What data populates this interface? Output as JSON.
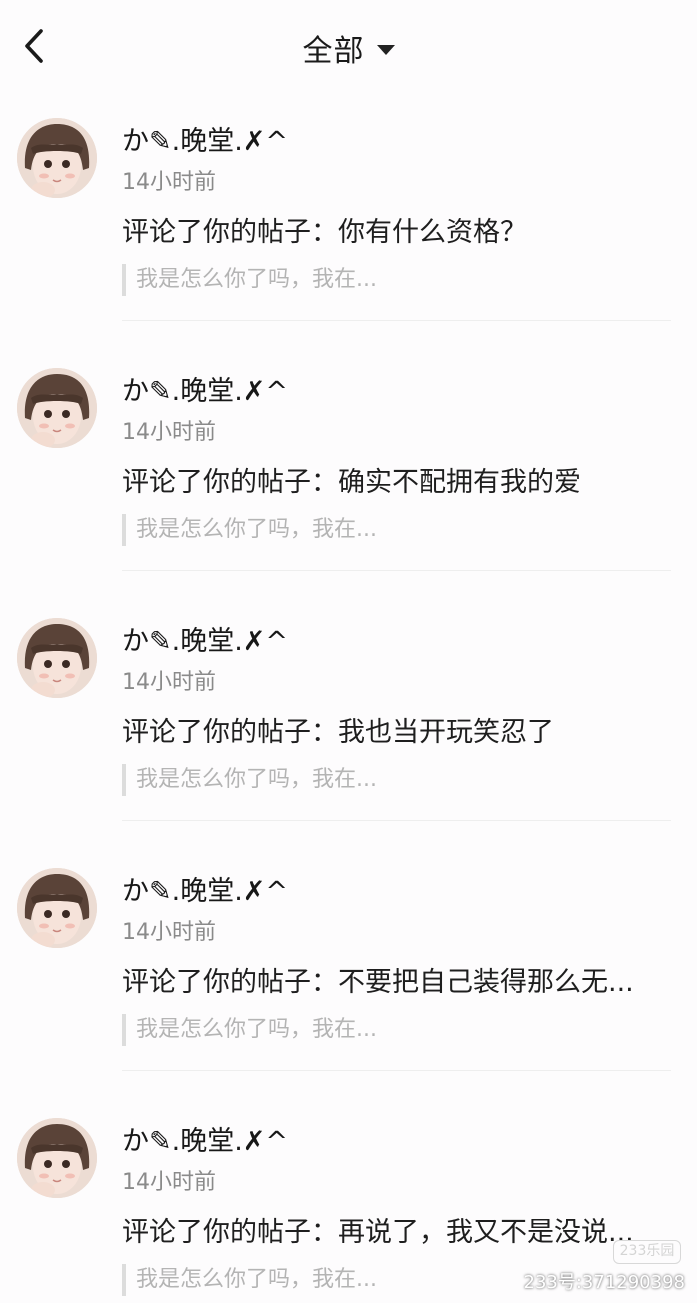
{
  "header": {
    "title": "全部",
    "back_icon": "chevron-left-icon",
    "dropdown_icon": "caret-down-icon"
  },
  "notifications": [
    {
      "user_name": "か✎.晚堂.✗^",
      "time": "14小时前",
      "comment": "评论了你的帖子：你有什么资格？",
      "quote": "我是怎么你了吗，我在..."
    },
    {
      "user_name": "か✎.晚堂.✗^",
      "time": "14小时前",
      "comment": "评论了你的帖子：确实不配拥有我的爱",
      "quote": "我是怎么你了吗，我在..."
    },
    {
      "user_name": "か✎.晚堂.✗^",
      "time": "14小时前",
      "comment": "评论了你的帖子：我也当开玩笑忍了",
      "quote": "我是怎么你了吗，我在..."
    },
    {
      "user_name": "か✎.晚堂.✗^",
      "time": "14小时前",
      "comment": "评论了你的帖子：不要把自己装得那么无...",
      "quote": "我是怎么你了吗，我在..."
    },
    {
      "user_name": "か✎.晚堂.✗^",
      "time": "14小时前",
      "comment": "评论了你的帖子：再说了，我又不是没说...",
      "quote": "我是怎么你了吗，我在..."
    }
  ],
  "watermark": {
    "logo_text": "233乐园",
    "id_text": "233号:371290398"
  },
  "colors": {
    "background": "#fdfcfd",
    "text_primary": "#1c1c1c",
    "text_secondary": "#8a8a8a",
    "quote_text": "#b4b4b4",
    "quote_bar": "#dcdcdc",
    "divider": "#eeeeee"
  }
}
